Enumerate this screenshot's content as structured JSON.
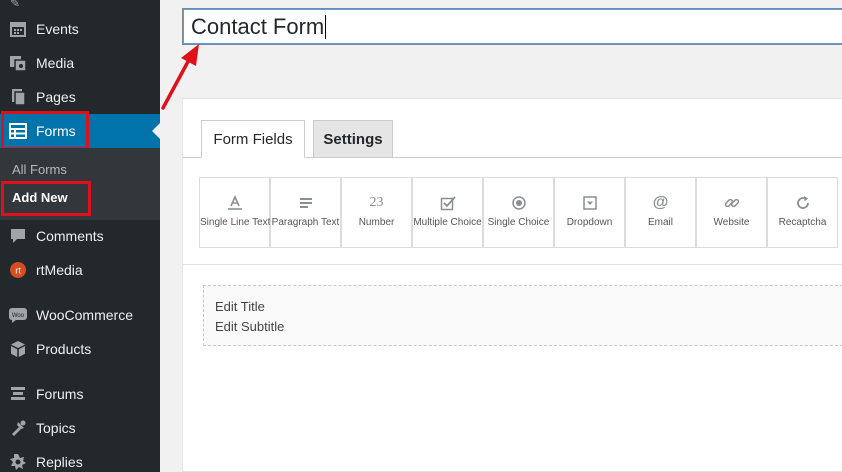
{
  "sidebar": {
    "items": [
      {
        "label": "Events",
        "icon": "calendar-icon"
      },
      {
        "label": "Media",
        "icon": "media-icon"
      },
      {
        "label": "Pages",
        "icon": "pages-icon"
      },
      {
        "label": "Forms",
        "icon": "forms-table-icon"
      },
      {
        "label": "Comments",
        "icon": "comments-icon"
      },
      {
        "label": "rtMedia",
        "icon": "rtmedia-icon"
      },
      {
        "label": "WooCommerce",
        "icon": "woocommerce-icon"
      },
      {
        "label": "Products",
        "icon": "products-icon"
      },
      {
        "label": "Forums",
        "icon": "forums-icon"
      },
      {
        "label": "Topics",
        "icon": "topics-icon"
      },
      {
        "label": "Replies",
        "icon": "replies-icon"
      }
    ],
    "submenu": {
      "all_forms": "All Forms",
      "add_new": "Add New"
    },
    "colors": {
      "background": "#23282d",
      "active": "#0073aa",
      "highlight": "#e0101a"
    }
  },
  "editor": {
    "title_value": "Contact Form"
  },
  "tabs": [
    {
      "label": "Form Fields"
    },
    {
      "label": "Settings"
    }
  ],
  "field_types": [
    {
      "label": "Single Line Text",
      "icon": "single-line-text-icon"
    },
    {
      "label": "Paragraph Text",
      "icon": "paragraph-text-icon"
    },
    {
      "label": "Number",
      "icon": "number-icon"
    },
    {
      "label": "Multiple Choice",
      "icon": "multiple-choice-icon"
    },
    {
      "label": "Single Choice",
      "icon": "single-choice-icon"
    },
    {
      "label": "Dropdown",
      "icon": "dropdown-icon"
    },
    {
      "label": "Email",
      "icon": "email-icon"
    },
    {
      "label": "Website",
      "icon": "website-icon"
    },
    {
      "label": "Recaptcha",
      "icon": "recaptcha-icon"
    }
  ],
  "number_icon_text": "23",
  "email_icon_text": "@",
  "preview": {
    "title": "Edit Title",
    "subtitle": "Edit Subtitle"
  }
}
